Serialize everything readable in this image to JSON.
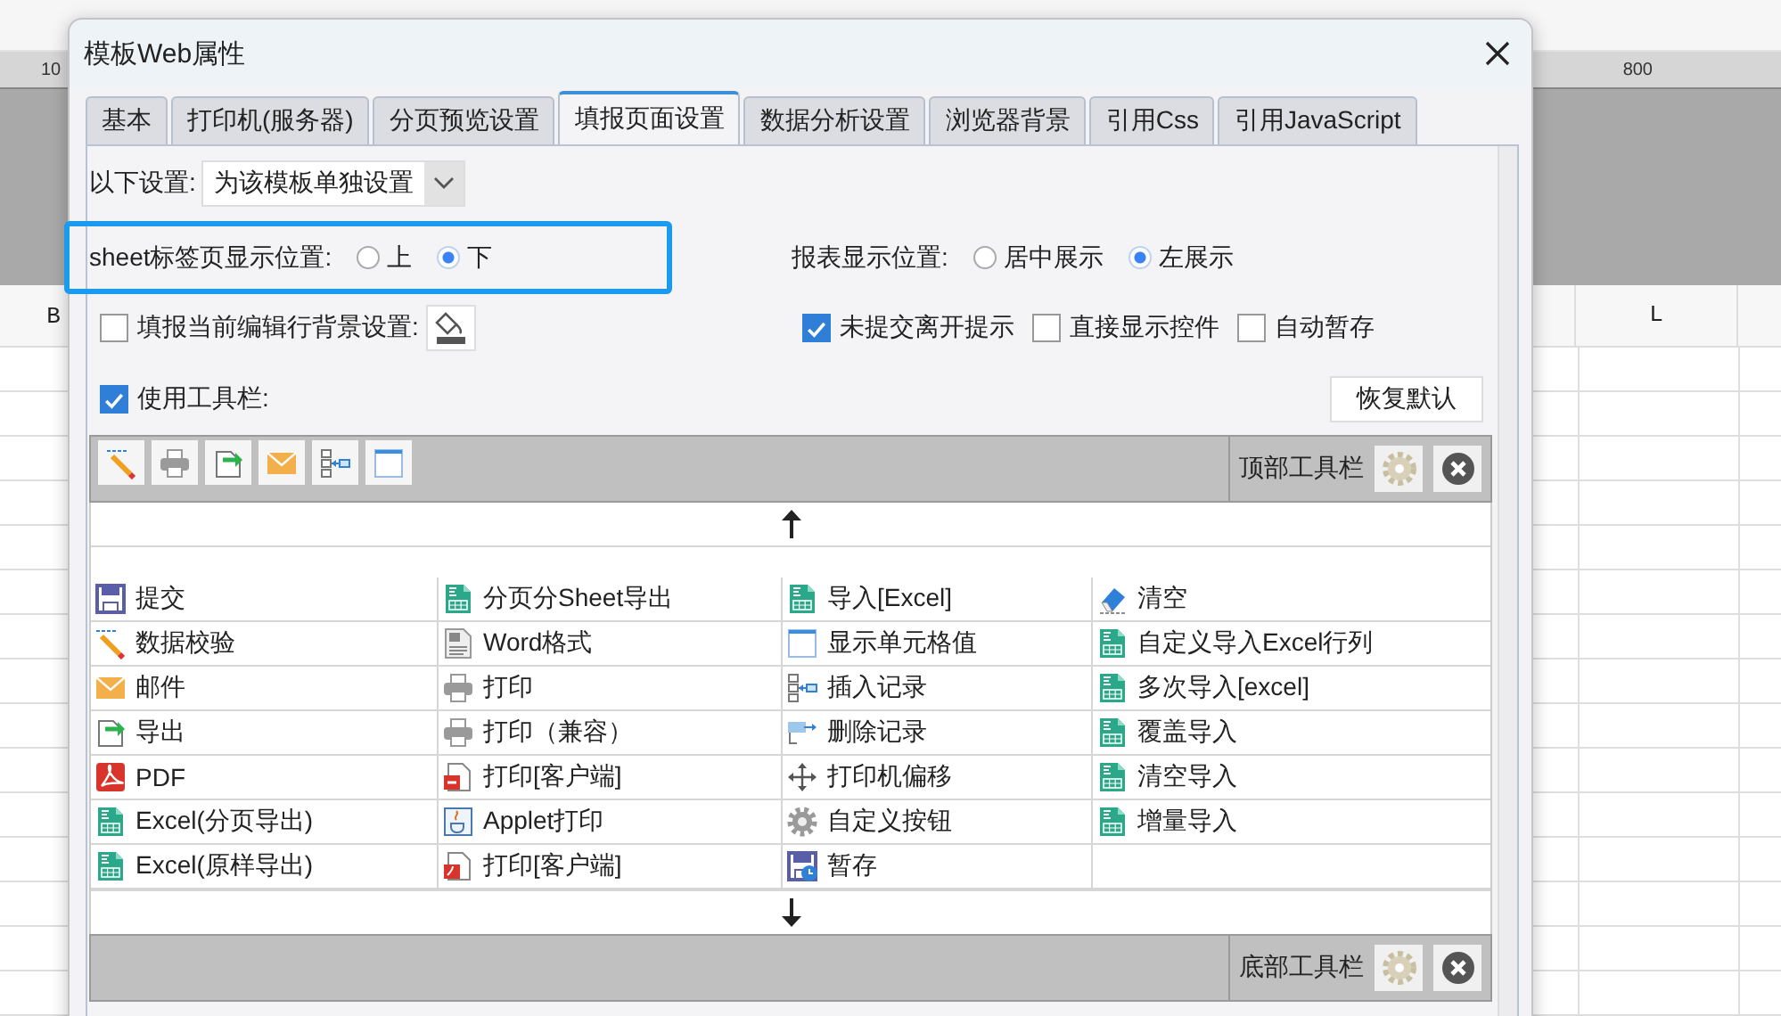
{
  "background": {
    "ruler_marks": [
      "10",
      "800"
    ],
    "column_headers": [
      "B",
      "L"
    ]
  },
  "dialog": {
    "title": "模板Web属性",
    "tabs": [
      {
        "label": "基本",
        "selected": false
      },
      {
        "label": "打印机(服务器)",
        "selected": false
      },
      {
        "label": "分页预览设置",
        "selected": false
      },
      {
        "label": "填报页面设置",
        "selected": true
      },
      {
        "label": "数据分析设置",
        "selected": false
      },
      {
        "label": "浏览器背景",
        "selected": false
      },
      {
        "label": "引用Css",
        "selected": false
      },
      {
        "label": "引用JavaScript",
        "selected": false
      }
    ],
    "scope": {
      "label": "以下设置:",
      "value": "为该模板单独设置"
    },
    "sheet_tab_position": {
      "label": "sheet标签页显示位置:",
      "highlighted": true,
      "options": [
        {
          "label": "上",
          "selected": false
        },
        {
          "label": "下",
          "selected": true
        }
      ]
    },
    "report_position": {
      "label": "报表显示位置:",
      "options": [
        {
          "label": "居中展示",
          "selected": false
        },
        {
          "label": "左展示",
          "selected": true
        }
      ]
    },
    "row_background": {
      "label": "填报当前编辑行背景设置:",
      "checked": false
    },
    "options": [
      {
        "label": "未提交离开提示",
        "checked": true
      },
      {
        "label": "直接显示控件",
        "checked": false
      },
      {
        "label": "自动暂存",
        "checked": false
      }
    ],
    "use_toolbar": {
      "label": "使用工具栏:",
      "checked": true
    },
    "restore_button": "恢复默认",
    "top_toolbar": {
      "label": "顶部工具栏",
      "buttons": [
        {
          "kind": "pencil"
        },
        {
          "kind": "printer"
        },
        {
          "kind": "export"
        },
        {
          "kind": "mail"
        },
        {
          "kind": "insert"
        },
        {
          "kind": "cell"
        }
      ]
    },
    "items": [
      {
        "label": "提交",
        "kind": "save"
      },
      {
        "label": "分页分Sheet导出",
        "kind": "excel"
      },
      {
        "label": "导入[Excel]",
        "kind": "excel"
      },
      {
        "label": "清空",
        "kind": "eraser"
      },
      {
        "label": "数据校验",
        "kind": "pencil"
      },
      {
        "label": "Word格式",
        "kind": "word"
      },
      {
        "label": "显示单元格值",
        "kind": "cell"
      },
      {
        "label": "自定义导入Excel行列",
        "kind": "excel"
      },
      {
        "label": "邮件",
        "kind": "mail"
      },
      {
        "label": "打印",
        "kind": "printer"
      },
      {
        "label": "插入记录",
        "kind": "insert"
      },
      {
        "label": "多次导入[excel]",
        "kind": "excel"
      },
      {
        "label": "导出",
        "kind": "export"
      },
      {
        "label": "打印（兼容）",
        "kind": "printer"
      },
      {
        "label": "删除记录",
        "kind": "delete"
      },
      {
        "label": "覆盖导入",
        "kind": "excel"
      },
      {
        "label": "PDF",
        "kind": "pdf"
      },
      {
        "label": "打印[客户端]",
        "kind": "flash"
      },
      {
        "label": "打印机偏移",
        "kind": "move"
      },
      {
        "label": "清空导入",
        "kind": "excel"
      },
      {
        "label": "Excel(分页导出)",
        "kind": "excel"
      },
      {
        "label": "Applet打印",
        "kind": "java"
      },
      {
        "label": "自定义按钮",
        "kind": "gear"
      },
      {
        "label": "增量导入",
        "kind": "excel"
      },
      {
        "label": "Excel(原样导出)",
        "kind": "excel"
      },
      {
        "label": "打印[客户端]",
        "kind": "pdfdoc"
      },
      {
        "label": "暂存",
        "kind": "saveclock"
      }
    ],
    "bottom_toolbar": {
      "label": "底部工具栏"
    }
  }
}
